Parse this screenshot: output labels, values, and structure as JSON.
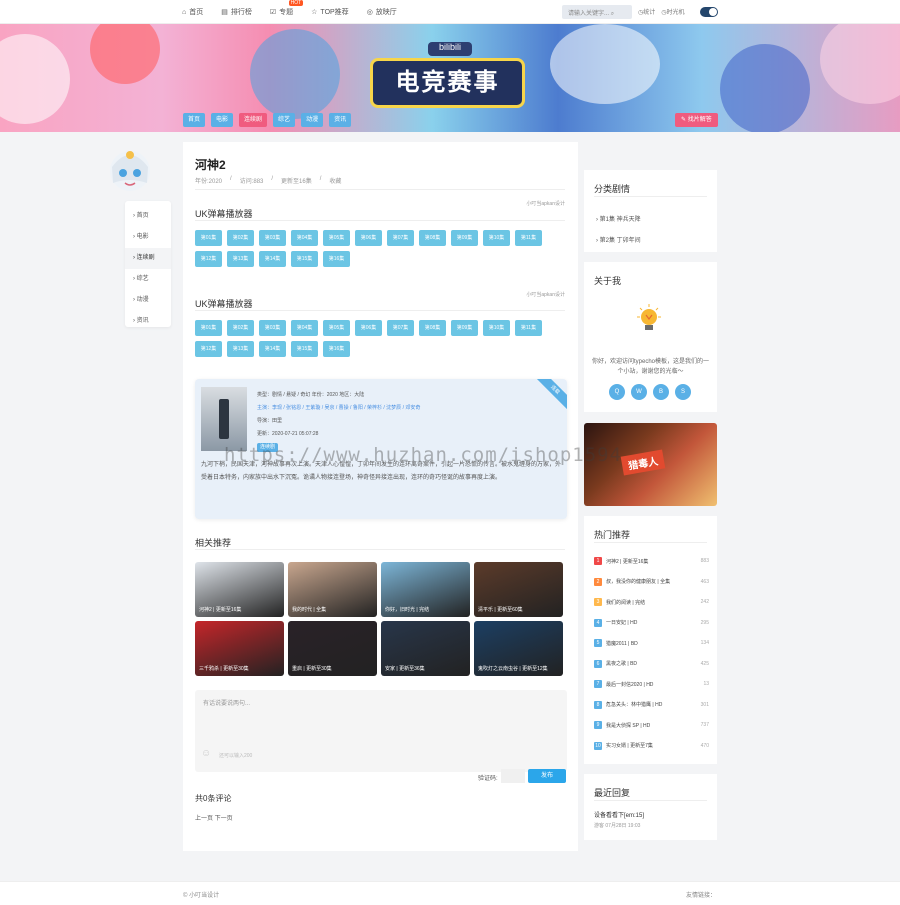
{
  "nav": {
    "items": [
      "首页",
      "排行榜",
      "专题",
      "TOP推荐",
      "放映厅"
    ],
    "hot_badge": "HOT",
    "search_placeholder": "请输入关键字...",
    "links": [
      "统计",
      "时光机"
    ]
  },
  "banner": {
    "sub_title": "bilibili",
    "title": "电竞赛事",
    "categories": [
      "首页",
      "电影",
      "连续剧",
      "综艺",
      "动漫",
      "资讯"
    ],
    "active_category": "连续剧",
    "right_button": "找片解答"
  },
  "sidenav": [
    "首页",
    "电影",
    "连续剧",
    "综艺",
    "动漫",
    "资讯"
  ],
  "movie": {
    "title": "河神2",
    "meta": [
      "年份:2020",
      "访问:883",
      "更新至16集",
      "收藏"
    ],
    "source1": {
      "title": "UK弹幕播放器",
      "src": "小叮当apkan设计",
      "episodes": [
        "第01集",
        "第02集",
        "第03集",
        "第04集",
        "第05集",
        "第06集",
        "第07集",
        "第08集",
        "第09集",
        "第10集",
        "第11集",
        "第12集",
        "第13集",
        "第14集",
        "第15集",
        "第16集"
      ]
    },
    "source2": {
      "title": "UK弹幕播放器",
      "src": "小叮当apkan设计",
      "episodes": [
        "第01集",
        "第02集",
        "第03集",
        "第04集",
        "第05集",
        "第06集",
        "第07集",
        "第08集",
        "第09集",
        "第10集",
        "第11集",
        "第12集",
        "第13集",
        "第14集",
        "第15集",
        "第16集"
      ]
    },
    "info": {
      "ribbon": "连载",
      "line1": "类型：剧情 / 悬疑 / 奇幻  年份：2020  地区：大陆",
      "line2": "主演：李现 / 张铭恩 / 王紫璇 / 吴京 / 曹操 / 鲁阳 / 荣梓杉 / 沈梦辰 / 邓安奇",
      "line3": "导演：田里",
      "line4": "更新：2020-07-21 05:07:28",
      "tag": "连续剧",
      "desc": "九河下梢，民国天津，河神故事再次上演。天津人心惶惶，丁卯年间发生的连环离奇案件，引起一片恐慌的传言。被水鬼缠身的万家，外受着日本特务，内家族中出水下沉冤。诡谲人物接连登场，神奇怪异接连出现，连环的奇巧怪诞的故事再度上演。"
    },
    "related_title": "相关推荐",
    "related": [
      {
        "name": "河神2 | 更新至16集",
        "color": "#dfe4ea"
      },
      {
        "name": "我的时代 | 全集",
        "color": "#c9a78f"
      },
      {
        "name": "你好，旧时光 | 完结",
        "color": "#7db6d8"
      },
      {
        "name": "清平乐 | 更新至60集",
        "color": "#5c3b2a"
      },
      {
        "name": "三千鸦杀 | 更新至30集",
        "color": "#c5262a"
      },
      {
        "name": "重启 | 更新至30集",
        "color": "#2a2228"
      },
      {
        "name": "安家 | 更新至36集",
        "color": "#28364a"
      },
      {
        "name": "鬼吹灯之云南虫谷 | 更新至12集",
        "color": "#1c3f63"
      }
    ],
    "comment_placeholder": "有话说要说两句...",
    "comment_hint": "还可以输入200",
    "captcha_label": "验证码:",
    "post_button": "发布",
    "comment_count": "共0条评论",
    "pager": "上一页 下一页"
  },
  "sidebar": {
    "categories_title": "分类剧情",
    "categories": [
      "第1集 神兵天降",
      "第2集 丁卯年间"
    ],
    "about_title": "关于我",
    "about_text": "你好，欢迎访问typecho模板，这是我们的一个小站，谢谢您的光临～",
    "social": [
      "Q",
      "W",
      "B",
      "S"
    ],
    "ad_text": "猎毒人",
    "hot_title": "热门推荐",
    "hot": [
      {
        "rank": "1",
        "name": "河神2 | 更新至16集",
        "views": "883",
        "color": "#f04848"
      },
      {
        "rank": "2",
        "name": "叔，我没你的健康朋友 | 全集",
        "views": "463",
        "color": "#ff8a3d"
      },
      {
        "rank": "3",
        "name": "我们的阅读 | 完结",
        "views": "242",
        "color": "#ffb84d"
      },
      {
        "rank": "4",
        "name": "一日安妃 | HD",
        "views": "295",
        "color": "#5ab0e6"
      },
      {
        "rank": "5",
        "name": "猎魔2011 | BD",
        "views": "134",
        "color": "#5ab0e6"
      },
      {
        "rank": "6",
        "name": "黑夜之歌 | BD",
        "views": "425",
        "color": "#5ab0e6"
      },
      {
        "rank": "7",
        "name": "最后一封信2020 | HD",
        "views": "13",
        "color": "#5ab0e6"
      },
      {
        "rank": "8",
        "name": "危急关头：林中猎鹰 | HD",
        "views": "301",
        "color": "#5ab0e6"
      },
      {
        "rank": "9",
        "name": "我是大侦探 SP | HD",
        "views": "737",
        "color": "#5ab0e6"
      },
      {
        "rank": "10",
        "name": "实习女婿 | 更新至7集",
        "views": "470",
        "color": "#5ab0e6"
      }
    ],
    "recent_title": "最近回复",
    "recent_text": "设备看看下[em:15]",
    "recent_time": "游客 07月28日 19:03"
  },
  "watermark": "https://www.huzhan.com/ishop1594",
  "footer": {
    "left": "© 小叮当设计",
    "right": "友情链接："
  }
}
